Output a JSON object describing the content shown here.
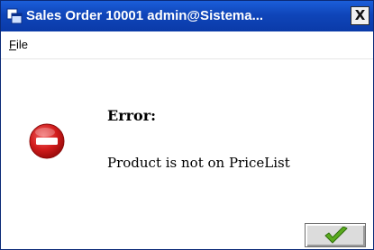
{
  "window": {
    "title": "Sales Order  10001  admin@Sistema...",
    "close_glyph": "X",
    "title_bar_color": "#0f45b9"
  },
  "menu": {
    "file_mnemonic": "F",
    "file_rest": "ile"
  },
  "dialog": {
    "icon": "error-stop-icon",
    "title": "Error:",
    "message": "Product is not on PriceList"
  },
  "buttons": {
    "ok_icon": "checkmark-icon",
    "ok_color": "#5aaa1e"
  }
}
